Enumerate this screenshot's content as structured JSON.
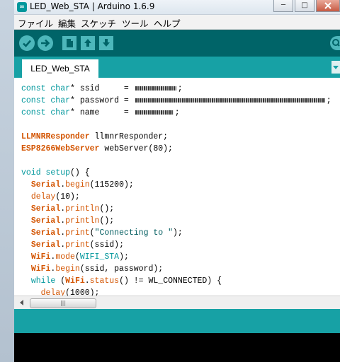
{
  "window": {
    "title": "LED_Web_STA | Arduino 1.6.9",
    "app_icon_glyph": "∞",
    "minimize_glyph": "─",
    "maximize_glyph": "□"
  },
  "menu": [
    "ファイル",
    "編集",
    "スケッチ",
    "ツール",
    "ヘルプ"
  ],
  "toolbar": {
    "buttons": [
      "verify-icon",
      "upload-icon",
      "new-icon",
      "open-icon",
      "save-icon",
      "serial-monitor-icon"
    ],
    "accent_color": "#4db7bb",
    "background_color": "#006468"
  },
  "tabs": [
    {
      "label": "LED_Web_STA"
    }
  ],
  "scrollbar": {
    "thumb_glyph": "|||"
  },
  "code": {
    "l1": {
      "type": "const char",
      "rest": "* ssid     = "
    },
    "l2": {
      "type": "const char",
      "rest": "* password = "
    },
    "l3": {
      "type": "const char",
      "rest": "* name     = "
    },
    "l5": {
      "cls": "LLMNRResponder",
      "rest": " llmnrResponder;"
    },
    "l6": {
      "cls": "ESP8266WebServer",
      "rest": " webServer(80);"
    },
    "l8": {
      "kw": "void",
      "fn": "setup",
      "rest": "() {"
    },
    "l9": {
      "obj": "Serial",
      "fn": "begin",
      "rest": "(115200);"
    },
    "l10": {
      "fn": "delay",
      "rest": "(10);"
    },
    "l11": {
      "obj": "Serial",
      "fn": "println",
      "rest": "();"
    },
    "l12": {
      "obj": "Serial",
      "fn": "println",
      "rest": "();"
    },
    "l13": {
      "obj": "Serial",
      "fn": "print",
      "str": "\"Connecting to \"",
      "rest": ");"
    },
    "l14": {
      "obj": "Serial",
      "fn": "print",
      "rest": "(ssid);"
    },
    "l15": {
      "obj": "WiFi",
      "fn": "mode",
      "cst": "WIFI_STA",
      "rest": ");"
    },
    "l16": {
      "obj": "WiFi",
      "fn": "begin",
      "rest": "(ssid, password);"
    },
    "l17": {
      "kw": "while",
      "obj": "WiFi",
      "fn": "status",
      "rest": "() != WL_CONNECTED) {"
    },
    "l18": {
      "fn": "delay",
      "rest": "(1000);"
    }
  }
}
